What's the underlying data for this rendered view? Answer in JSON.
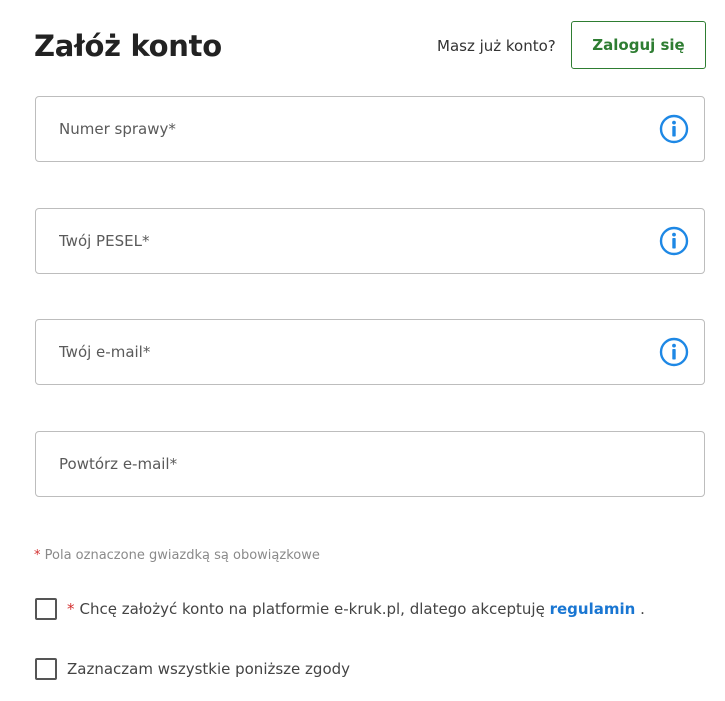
{
  "header": {
    "title": "Załóż konto",
    "login_prompt": "Masz już konto?",
    "login_button_label": "Zaloguj się"
  },
  "form": {
    "case_number": {
      "placeholder": "Numer sprawy*",
      "value": ""
    },
    "pesel": {
      "placeholder": "Twój PESEL*",
      "value": ""
    },
    "email": {
      "placeholder": "Twój e-mail*",
      "value": ""
    },
    "email_repeat": {
      "placeholder": "Powtórz e-mail*",
      "value": ""
    }
  },
  "required_note": {
    "asterisk": "*",
    "text": "Pola oznaczone gwiazdką są obowiązkowe"
  },
  "consents": {
    "terms": {
      "asterisk": "*",
      "text": "Chcę założyć konto na platformie e-kruk.pl, dlatego akceptuję",
      "link_label": "regulamin",
      "suffix": ".",
      "checked": false
    },
    "select_all": {
      "text": "Zaznaczam wszystkie poniższe zgody",
      "checked": false
    }
  },
  "icons": {
    "info": "info-icon"
  },
  "colors": {
    "primary_green": "#2e7d32",
    "info_blue": "#1e88e5",
    "link_blue": "#1976d2",
    "required_red": "#d32f2f",
    "border_gray": "#bdbdbd"
  }
}
